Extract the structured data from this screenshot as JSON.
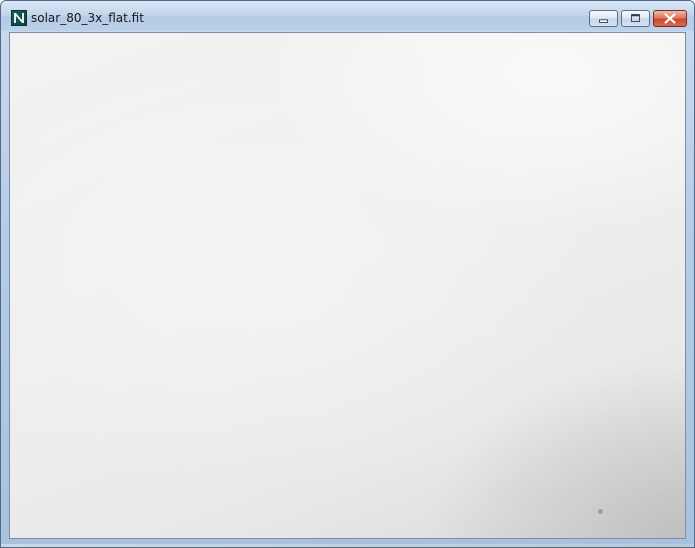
{
  "window": {
    "title": "solar_80_3x_flat.fit",
    "app_icon": "image-viewer-icon"
  },
  "caption_buttons": {
    "minimize_icon": "minimize-icon",
    "maximize_icon": "maximize-icon",
    "close_icon": "close-icon",
    "close_color": "#c84a30"
  },
  "canvas": {
    "content": "flat-field image (uniform light gray)",
    "background_color": "#efefef"
  }
}
